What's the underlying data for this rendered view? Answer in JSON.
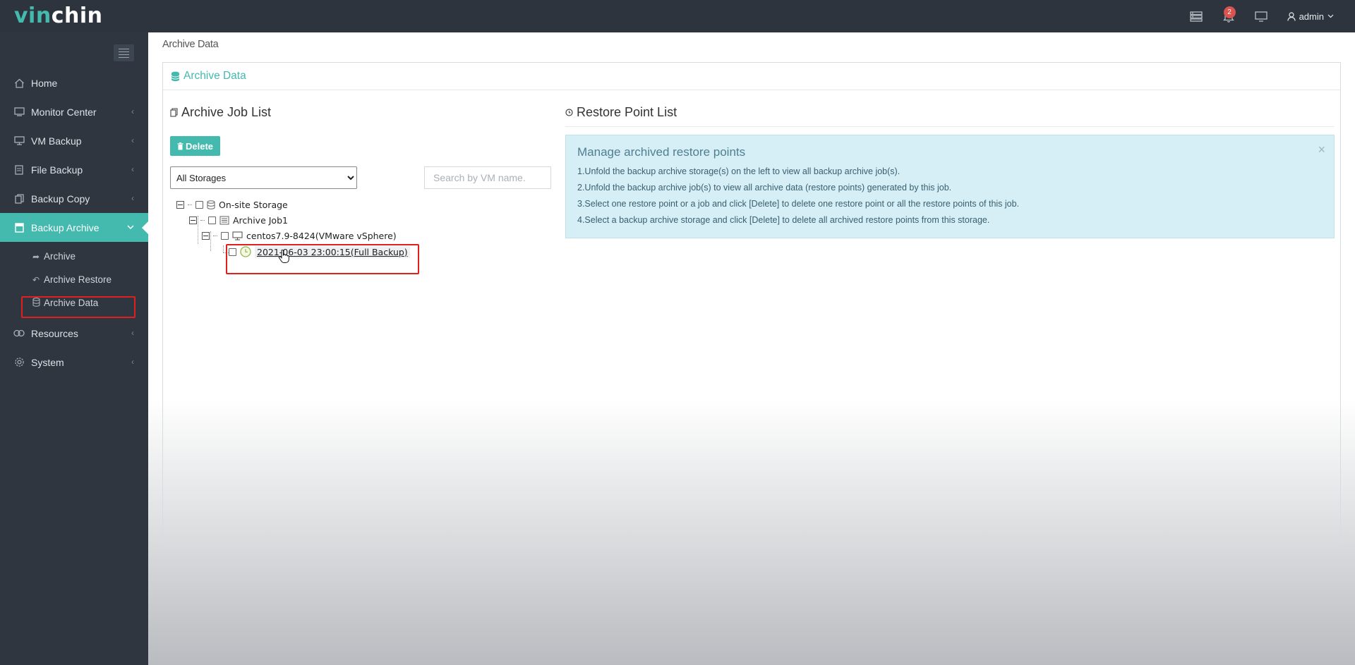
{
  "topbar": {
    "logo_part1": "vin",
    "logo_part2": "chin",
    "notification_count": "2",
    "user_label": "admin"
  },
  "sidebar": {
    "items": [
      {
        "label": "Home",
        "icon": "home-icon"
      },
      {
        "label": "Monitor Center",
        "icon": "monitor-icon"
      },
      {
        "label": "VM Backup",
        "icon": "desktop-icon"
      },
      {
        "label": "File Backup",
        "icon": "file-icon"
      },
      {
        "label": "Backup Copy",
        "icon": "copy-icon"
      },
      {
        "label": "Backup Archive",
        "icon": "archive-icon"
      },
      {
        "label": "Resources",
        "icon": "resources-icon"
      },
      {
        "label": "System",
        "icon": "gear-icon"
      }
    ],
    "subitems": [
      {
        "label": "Archive",
        "icon": "share-icon"
      },
      {
        "label": "Archive Restore",
        "icon": "reply-icon"
      },
      {
        "label": "Archive Data",
        "icon": "database-icon"
      }
    ]
  },
  "main": {
    "breadcrumb": "Archive Data",
    "panel_title": "Archive Data",
    "left": {
      "title": "Archive Job List",
      "delete_label": "Delete",
      "storage_options": [
        "All Storages"
      ],
      "storage_selected": "All Storages",
      "search_placeholder": "Search by VM name."
    },
    "tree": {
      "storage": "On-site Storage",
      "job": "Archive Job1",
      "vm": "centos7.9-8424(VMware vSphere)",
      "restore_point": "2021-06-03 23:00:15(Full Backup)"
    },
    "right": {
      "title": "Restore Point List",
      "info_title": "Manage archived restore points",
      "info_lines": [
        "1.Unfold the backup archive storage(s) on the left to view all backup archive job(s).",
        "2.Unfold the backup archive job(s) to view all archive data (restore points) generated by this job.",
        "3.Select one restore point or a job and click [Delete] to delete one restore point or all the restore points of this job.",
        "4.Select a backup archive storage and click [Delete] to delete all archived restore points from this storage."
      ],
      "close_glyph": "×"
    }
  },
  "colors": {
    "accent": "#44b9ae",
    "topbar": "#2d343e",
    "sidebar": "#2f3640",
    "highlight": "#e0201e",
    "info_bg": "#d6eef5"
  }
}
